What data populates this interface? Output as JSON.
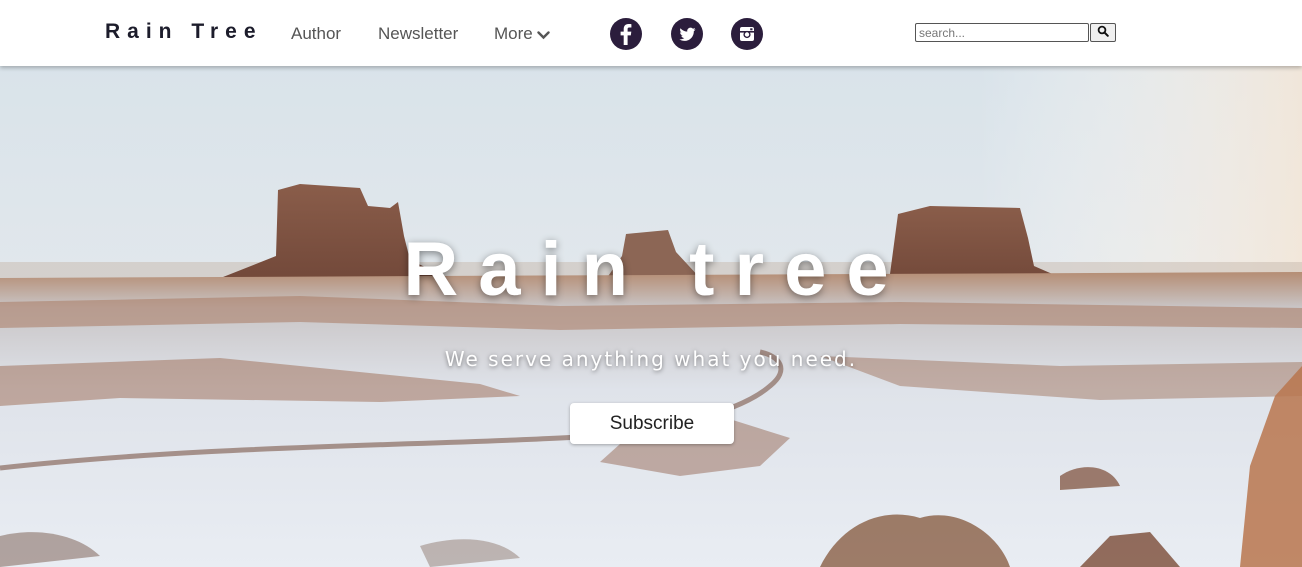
{
  "navbar": {
    "brand": "Rain Tree",
    "links": [
      {
        "label": "Author"
      },
      {
        "label": "Newsletter"
      },
      {
        "label": "More"
      }
    ],
    "social_icons": [
      "facebook-icon",
      "twitter-icon",
      "instagram-icon"
    ],
    "search": {
      "placeholder": "search...",
      "value": ""
    }
  },
  "hero": {
    "title": "Rain tree",
    "subtitle": "We serve anything what you need.",
    "button_label": "Subscribe"
  },
  "colors": {
    "brand_text": "#1c1c2b",
    "social_bg": "#2b1d3c",
    "nav_link": "#555555"
  }
}
